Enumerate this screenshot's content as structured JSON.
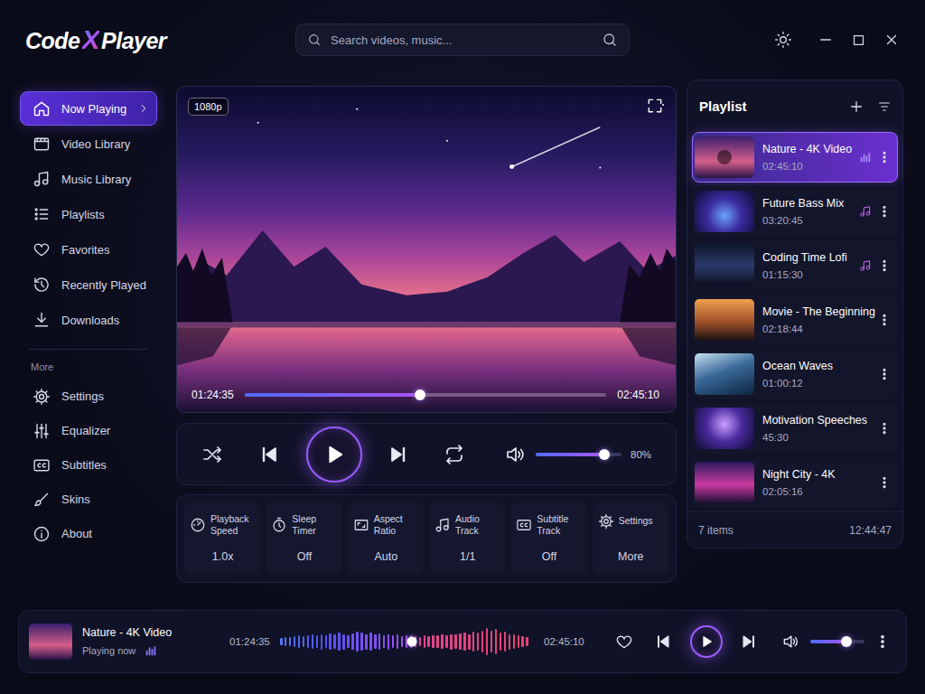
{
  "app": {
    "logo": [
      "Code",
      "X",
      "Player"
    ]
  },
  "search": {
    "placeholder": "Search videos, music..."
  },
  "sidebar": {
    "items": [
      {
        "label": "Now Playing",
        "selected": true
      },
      {
        "label": "Video Library",
        "selected": false
      },
      {
        "label": "Music Library",
        "selected": false
      },
      {
        "label": "Playlists",
        "selected": false
      },
      {
        "label": "Favorites",
        "selected": false
      },
      {
        "label": "Recently Played",
        "selected": false
      },
      {
        "label": "Downloads",
        "selected": false
      }
    ],
    "section_title": "More",
    "more_items": [
      {
        "label": "Settings",
        "selected": false
      },
      {
        "label": "Equalizer",
        "selected": false
      },
      {
        "label": "Subtitles",
        "selected": false
      },
      {
        "label": "Skins",
        "selected": false
      },
      {
        "label": "About",
        "selected": false
      }
    ]
  },
  "video": {
    "quality": "1080p",
    "elapsed": "01:24:35",
    "duration": "02:45:10",
    "level": 0.485
  },
  "controls": {
    "playing": false,
    "volume": {
      "level": 0.8,
      "reading": "80%"
    }
  },
  "quick_settings": [
    {
      "label": "Playback Speed",
      "value": "1.0x"
    },
    {
      "label": "Sleep Timer",
      "value": "Off"
    },
    {
      "label": "Aspect Ratio",
      "value": "Auto"
    },
    {
      "label": "Audio Track",
      "value": "1/1"
    },
    {
      "label": "Subtitle Track",
      "value": "Off"
    },
    {
      "label": "Settings",
      "value": "More"
    }
  ],
  "playlist": {
    "title": "Playlist",
    "items": [
      {
        "title": "Nature - 4K Video",
        "duration": "02:45:10",
        "kind": "video",
        "selected": true
      },
      {
        "title": "Future Bass Mix",
        "duration": "03:20:45",
        "kind": "music",
        "selected": false
      },
      {
        "title": "Coding Time Lofi",
        "duration": "01:15:30",
        "kind": "music",
        "selected": false
      },
      {
        "title": "Movie - The Beginning",
        "duration": "02:18:44",
        "kind": "video",
        "selected": false
      },
      {
        "title": "Ocean Waves",
        "duration": "01:00:12",
        "kind": "video",
        "selected": false
      },
      {
        "title": "Motivation Speeches",
        "duration": "45:30",
        "kind": "video",
        "selected": false
      },
      {
        "title": "Night City - 4K",
        "duration": "02:05:16",
        "kind": "video",
        "selected": false
      }
    ],
    "count": "7 items",
    "total": "12:44:47"
  },
  "now_playing": {
    "title": "Nature - 4K Video",
    "status": "Playing now",
    "elapsed": "01:24:35",
    "duration": "02:45:10",
    "level": 0.53,
    "waveform": [
      0.15,
      0.2,
      0.25,
      0.3,
      0.35,
      0.3,
      0.4,
      0.45,
      0.35,
      0.5,
      0.4,
      0.55,
      0.45,
      0.6,
      0.5,
      0.4,
      0.55,
      0.7,
      0.6,
      0.5,
      0.65,
      0.45,
      0.55,
      0.4,
      0.5,
      0.35,
      0.45,
      0.3,
      0.4,
      0.35,
      0.3,
      0.25,
      0.35,
      0.3,
      0.4,
      0.35,
      0.45,
      0.4,
      0.5,
      0.45,
      0.55,
      0.6,
      0.5,
      0.7,
      0.65,
      0.8,
      1.0,
      0.75,
      0.9,
      0.6,
      0.7,
      0.5,
      0.45,
      0.35,
      0.3,
      0.2
    ],
    "favorite": false,
    "playing": false,
    "volume": 0.67
  }
}
